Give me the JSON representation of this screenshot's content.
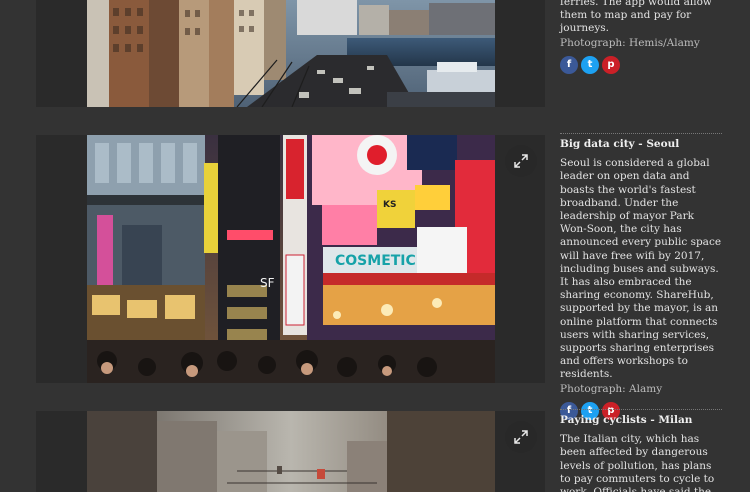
{
  "captions": [
    {
      "title": "",
      "body": "ferries. The app would allow them to map and pay for journeys.",
      "credit": "Photograph: Hemis/Alamy"
    },
    {
      "title": "Big data city - Seoul",
      "body": "Seoul is considered a global leader on open data and boasts the world's fastest broadband. Under the leadership of mayor Park Won-Soon, the city has announced every public space will have free wifi by 2017, including buses and subways. It has also embraced the sharing economy. ShareHub, supported by the mayor, is an online platform that connects users with sharing services, supports sharing enterprises and offers workshops to residents.",
      "credit": "Photograph: Alamy"
    },
    {
      "title": "Paying cyclists - Milan",
      "body": "The Italian city, which has been affected by dangerous levels of pollution, has plans to pay commuters to cycle to work. Officials have said the",
      "credit": ""
    }
  ],
  "share": {
    "facebook": "f",
    "twitter": "t",
    "pinterest": "p"
  },
  "signs": {
    "cosmetic": "COSMETIC",
    "ks": "KS",
    "sf": "SF"
  },
  "colors": {
    "background": "#333333",
    "card": "#2a2a2a",
    "facebook": "#3b5998",
    "twitter": "#1da1f2",
    "pinterest": "#cb2027"
  }
}
